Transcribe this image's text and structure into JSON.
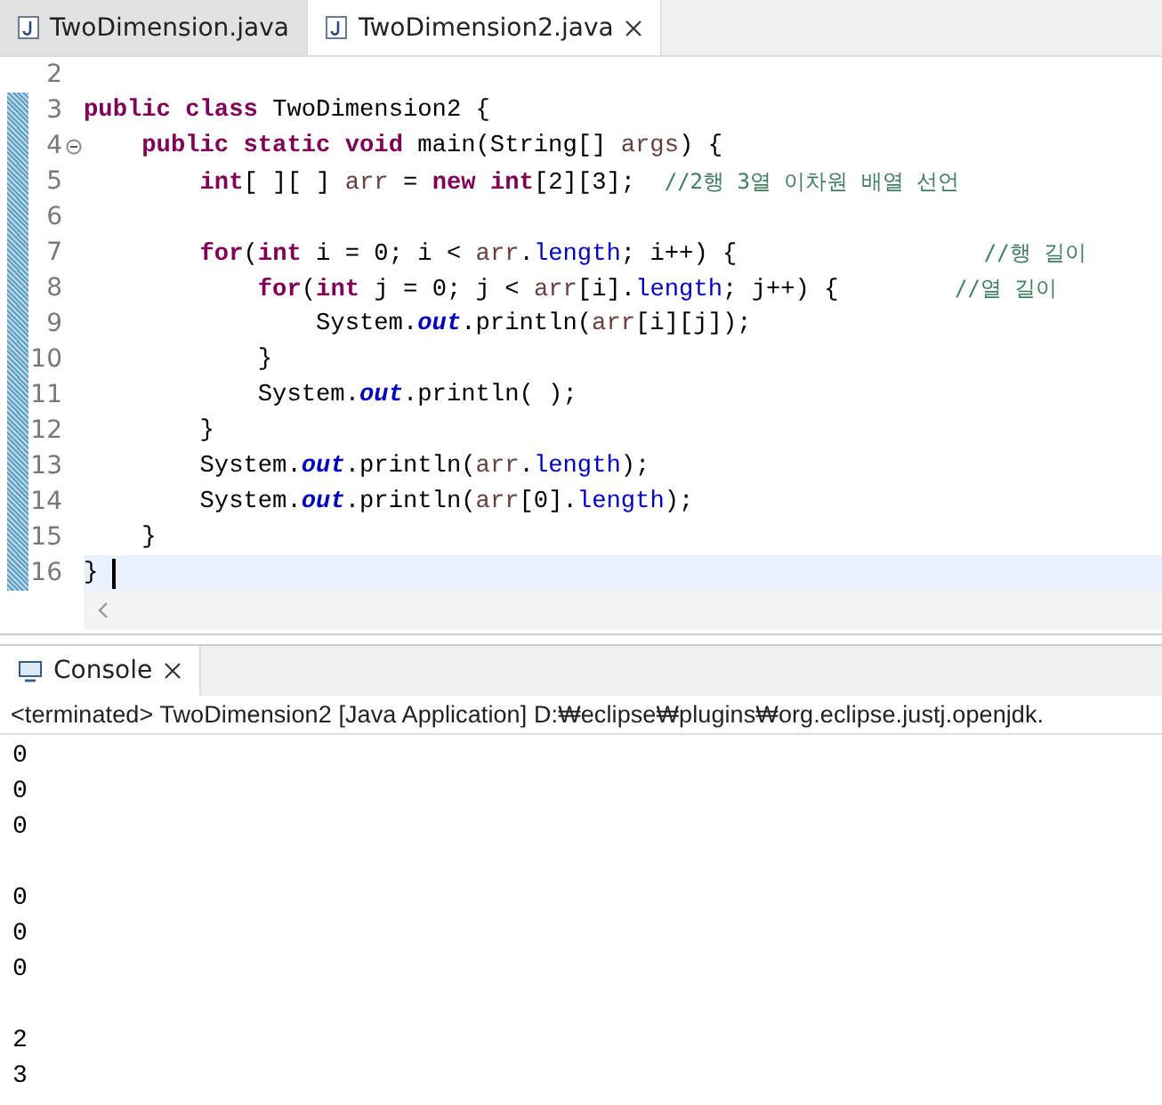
{
  "editor_tabs": [
    {
      "label": "TwoDimension.java",
      "selected": false
    },
    {
      "label": "TwoDimension2.java",
      "selected": true
    }
  ],
  "editor": {
    "lines": [
      {
        "number": "2",
        "changed": false,
        "fold": false,
        "current": false
      },
      {
        "number": "3",
        "changed": true,
        "fold": false,
        "current": false,
        "segments": [
          {
            "kind": "keyword",
            "text": "public "
          },
          {
            "kind": "keyword",
            "text": "class "
          },
          {
            "kind": "plain",
            "text": "TwoDimension2 {"
          }
        ]
      },
      {
        "number": "4",
        "changed": true,
        "fold": true,
        "current": false,
        "segments": [
          {
            "kind": "keyword",
            "text": "    public "
          },
          {
            "kind": "keyword",
            "text": "static "
          },
          {
            "kind": "keyword",
            "text": "void "
          },
          {
            "kind": "plain",
            "text": "main(String[] "
          },
          {
            "kind": "local",
            "text": "args"
          },
          {
            "kind": "plain",
            "text": ") {"
          }
        ]
      },
      {
        "number": "5",
        "changed": true,
        "fold": false,
        "current": false,
        "segments": [
          {
            "kind": "keyword",
            "text": "        int"
          },
          {
            "kind": "plain",
            "text": "[ ][ ] "
          },
          {
            "kind": "local",
            "text": "arr"
          },
          {
            "kind": "plain",
            "text": " = "
          },
          {
            "kind": "keyword",
            "text": "new "
          },
          {
            "kind": "keyword",
            "text": "int"
          },
          {
            "kind": "plain",
            "text": "[2][3];  "
          },
          {
            "kind": "comment",
            "text": "//2행 3열 이차원 배열 선언"
          }
        ]
      },
      {
        "number": "6",
        "changed": true,
        "fold": false,
        "current": false
      },
      {
        "number": "7",
        "changed": true,
        "fold": false,
        "current": false,
        "segments": [
          {
            "kind": "keyword",
            "text": "        for"
          },
          {
            "kind": "plain",
            "text": "("
          },
          {
            "kind": "keyword",
            "text": "int"
          },
          {
            "kind": "plain",
            "text": " i = 0; i < "
          },
          {
            "kind": "local",
            "text": "arr"
          },
          {
            "kind": "plain",
            "text": "."
          },
          {
            "kind": "field",
            "text": "length"
          },
          {
            "kind": "plain",
            "text": "; i++) {                 "
          },
          {
            "kind": "comment",
            "text": "//행 길이"
          }
        ]
      },
      {
        "number": "8",
        "changed": true,
        "fold": false,
        "current": false,
        "segments": [
          {
            "kind": "keyword",
            "text": "            for"
          },
          {
            "kind": "plain",
            "text": "("
          },
          {
            "kind": "keyword",
            "text": "int"
          },
          {
            "kind": "plain",
            "text": " j = 0; j < "
          },
          {
            "kind": "local",
            "text": "arr"
          },
          {
            "kind": "plain",
            "text": "[i]."
          },
          {
            "kind": "field",
            "text": "length"
          },
          {
            "kind": "plain",
            "text": "; j++) {        "
          },
          {
            "kind": "comment",
            "text": "//열 길이"
          }
        ]
      },
      {
        "number": "9",
        "changed": true,
        "fold": false,
        "current": false,
        "segments": [
          {
            "kind": "plain",
            "text": "                System."
          },
          {
            "kind": "static",
            "text": "out"
          },
          {
            "kind": "plain",
            "text": ".println("
          },
          {
            "kind": "local",
            "text": "arr"
          },
          {
            "kind": "plain",
            "text": "[i][j]);"
          }
        ]
      },
      {
        "number": "10",
        "changed": true,
        "fold": false,
        "current": false,
        "segments": [
          {
            "kind": "plain",
            "text": "            }"
          }
        ]
      },
      {
        "number": "11",
        "changed": true,
        "fold": false,
        "current": false,
        "segments": [
          {
            "kind": "plain",
            "text": "            System."
          },
          {
            "kind": "static",
            "text": "out"
          },
          {
            "kind": "plain",
            "text": ".println( );"
          }
        ]
      },
      {
        "number": "12",
        "changed": true,
        "fold": false,
        "current": false,
        "segments": [
          {
            "kind": "plain",
            "text": "        }"
          }
        ]
      },
      {
        "number": "13",
        "changed": true,
        "fold": false,
        "current": false,
        "segments": [
          {
            "kind": "plain",
            "text": "        System."
          },
          {
            "kind": "static",
            "text": "out"
          },
          {
            "kind": "plain",
            "text": ".println("
          },
          {
            "kind": "local",
            "text": "arr"
          },
          {
            "kind": "plain",
            "text": "."
          },
          {
            "kind": "field",
            "text": "length"
          },
          {
            "kind": "plain",
            "text": ");"
          }
        ]
      },
      {
        "number": "14",
        "changed": true,
        "fold": false,
        "current": false,
        "segments": [
          {
            "kind": "plain",
            "text": "        System."
          },
          {
            "kind": "static",
            "text": "out"
          },
          {
            "kind": "plain",
            "text": ".println("
          },
          {
            "kind": "local",
            "text": "arr"
          },
          {
            "kind": "plain",
            "text": "[0]."
          },
          {
            "kind": "field",
            "text": "length"
          },
          {
            "kind": "plain",
            "text": ");"
          }
        ]
      },
      {
        "number": "15",
        "changed": true,
        "fold": false,
        "current": false,
        "segments": [
          {
            "kind": "plain",
            "text": "    }"
          }
        ]
      },
      {
        "number": "16",
        "changed": true,
        "fold": false,
        "current": true,
        "segments": [
          {
            "kind": "plain",
            "text": "} "
          }
        ]
      }
    ]
  },
  "console": {
    "tab": {
      "label": "Console",
      "selected": true
    },
    "status": "<terminated> TwoDimension2 [Java Application] D:₩eclipse₩plugins₩org.eclipse.justj.openjdk.",
    "output_groups": [
      [
        "0",
        "0",
        "0"
      ],
      [
        "0",
        "0",
        "0"
      ],
      [
        "2",
        "3"
      ]
    ]
  }
}
